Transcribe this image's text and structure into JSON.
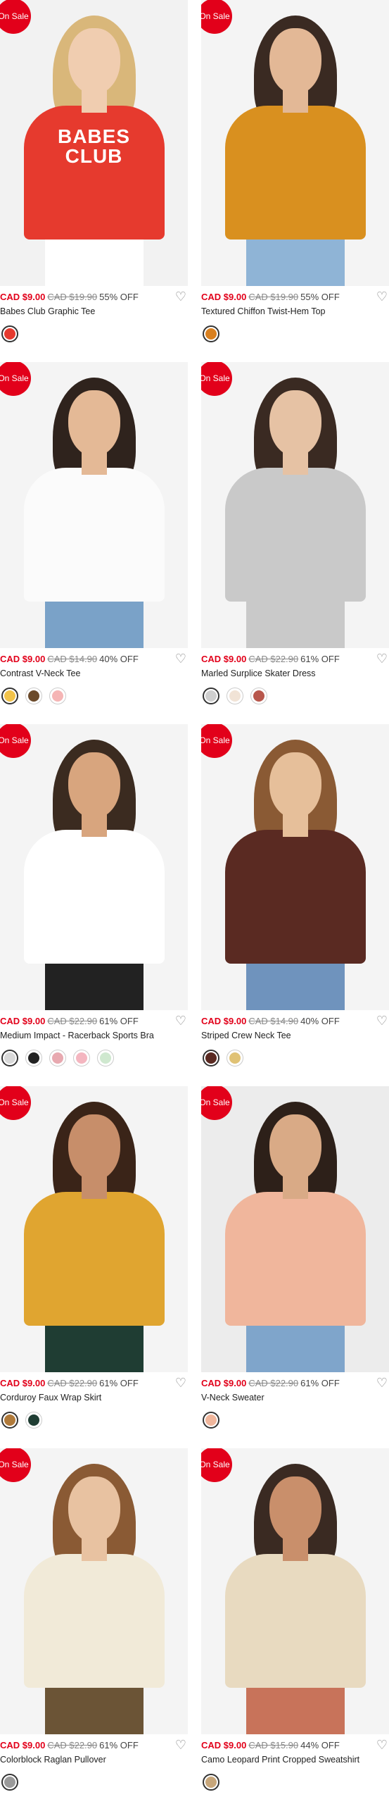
{
  "products": [
    {
      "badge": "On Sale",
      "price": "CAD $9.00",
      "original_price": "CAD $19.90",
      "discount": "55% OFF",
      "name": "Babes Club Graphic Tee",
      "print_text": "BABES\nCLUB",
      "colors": {
        "bg": "#f2f2f2",
        "hair": "#d9b77a",
        "skin": "#f0cdb0",
        "top": "#e63a2e",
        "bottom": "#ffffff"
      },
      "swatches": [
        "#e63a2e"
      ]
    },
    {
      "badge": "On Sale",
      "price": "CAD $9.00",
      "original_price": "CAD $19.90",
      "discount": "55% OFF",
      "name": "Textured Chiffon Twist-Hem Top",
      "print_text": "",
      "colors": {
        "bg": "#f4f4f4",
        "hair": "#3a2a22",
        "skin": "#e3b896",
        "top": "#d9901f",
        "bottom": "#8fb4d6"
      },
      "swatches": [
        "#d9801f"
      ]
    },
    {
      "badge": "On Sale",
      "price": "CAD $9.00",
      "original_price": "CAD $14.90",
      "discount": "40% OFF",
      "name": "Contrast V-Neck Tee",
      "print_text": "",
      "colors": {
        "bg": "#f4f4f4",
        "hair": "#2f231d",
        "skin": "#e4b996",
        "top": "#fbfbfb",
        "bottom": "#7aa2c8"
      },
      "swatches": [
        "#f2c34a",
        "#6b4a2a",
        "#f5b5b5"
      ]
    },
    {
      "badge": "On Sale",
      "price": "CAD $9.00",
      "original_price": "CAD $22.90",
      "discount": "61% OFF",
      "name": "Marled Surplice Skater Dress",
      "print_text": "",
      "colors": {
        "bg": "#f4f4f4",
        "hair": "#3a2a22",
        "skin": "#e6c2a4",
        "top": "#c9c9c9",
        "bottom": "#c9c9c9"
      },
      "swatches": [
        "#cfcfcf",
        "#f1e3d6",
        "#b8574c"
      ]
    },
    {
      "badge": "On Sale",
      "price": "CAD $9.00",
      "original_price": "CAD $22.90",
      "discount": "61% OFF",
      "name": "Medium Impact - Racerback Sports Bra",
      "print_text": "",
      "colors": {
        "bg": "#f4f4f4",
        "hair": "#3b2b20",
        "skin": "#d8a57e",
        "top": "#ffffff",
        "bottom": "#222222"
      },
      "swatches": [
        "#d9d9d9",
        "#222222",
        "#e8a9b0",
        "#f4b6c0",
        "#cfe8cf"
      ]
    },
    {
      "badge": "On Sale",
      "price": "CAD $9.00",
      "original_price": "CAD $14.90",
      "discount": "40% OFF",
      "name": "Striped Crew Neck Tee",
      "print_text": "",
      "colors": {
        "bg": "#f4f4f4",
        "hair": "#8a5a34",
        "skin": "#e6bf9a",
        "top": "#5a2a22",
        "bottom": "#6f93bd"
      },
      "swatches": [
        "#5a2a22",
        "#e0c275"
      ]
    },
    {
      "badge": "On Sale",
      "price": "CAD $9.00",
      "original_price": "CAD $22.90",
      "discount": "61% OFF",
      "name": "Corduroy Faux Wrap Skirt",
      "print_text": "",
      "colors": {
        "bg": "#f4f4f4",
        "hair": "#3a2418",
        "skin": "#c78e6a",
        "top": "#e0a530",
        "bottom": "#1f3d33"
      },
      "swatches": [
        "#b07a3a",
        "#1f3d33"
      ]
    },
    {
      "badge": "On Sale",
      "price": "CAD $9.00",
      "original_price": "CAD $22.90",
      "discount": "61% OFF",
      "name": "V-Neck Sweater",
      "print_text": "",
      "colors": {
        "bg": "#ececec",
        "hair": "#2d2019",
        "skin": "#d9aa86",
        "top": "#f0b69c",
        "bottom": "#7fa5cb"
      },
      "swatches": [
        "#f0b69c"
      ]
    },
    {
      "badge": "On Sale",
      "price": "CAD $9.00",
      "original_price": "CAD $22.90",
      "discount": "61% OFF",
      "name": "Colorblock Raglan Pullover",
      "print_text": "",
      "colors": {
        "bg": "#f4f4f4",
        "hair": "#8a5a34",
        "skin": "#e8c2a1",
        "top": "#f1ead8",
        "bottom": "#6b5436"
      },
      "swatches": [
        "#9a9a9a"
      ]
    },
    {
      "badge": "On Sale",
      "price": "CAD $9.00",
      "original_price": "CAD $15.90",
      "discount": "44% OFF",
      "name": "Camo Leopard Print Cropped Sweatshirt",
      "print_text": "",
      "colors": {
        "bg": "#f4f4f4",
        "hair": "#3a2a22",
        "skin": "#c98f6b",
        "top": "#e8dac0",
        "bottom": "#c8735a"
      },
      "swatches": [
        "#c7a67a"
      ]
    }
  ],
  "icons": {
    "wishlist": "heart-outline-icon"
  }
}
